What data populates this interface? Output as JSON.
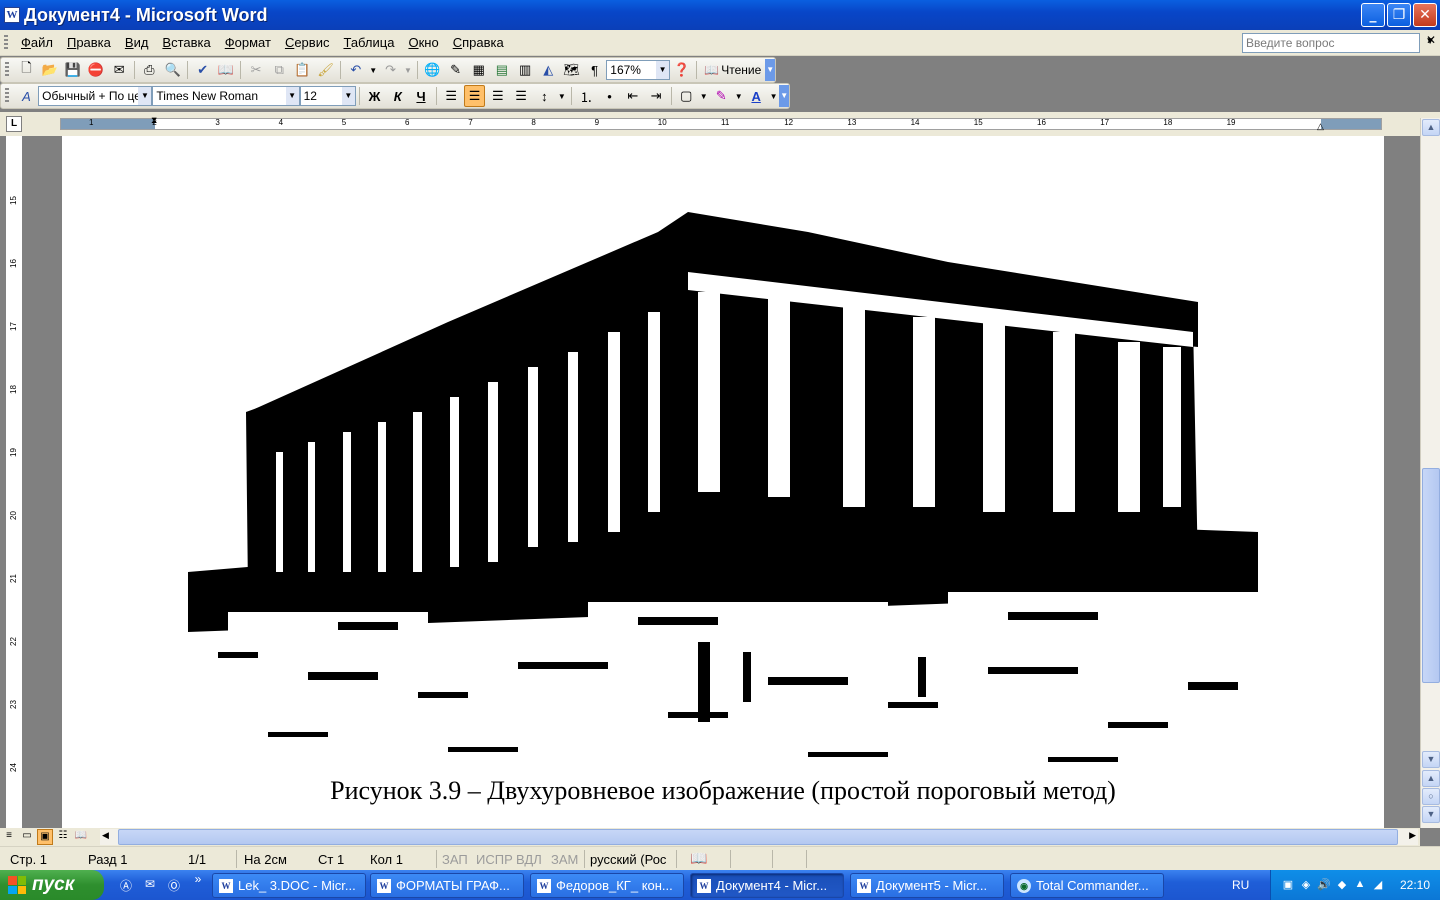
{
  "window": {
    "title": "Документ4 - Microsoft Word",
    "minimize": "_",
    "maximize": "❐",
    "close": "✕"
  },
  "menu": {
    "items": [
      "Файл",
      "Правка",
      "Вид",
      "Вставка",
      "Формат",
      "Сервис",
      "Таблица",
      "Окно",
      "Справка"
    ],
    "ask_placeholder": "Введите вопрос"
  },
  "toolbar_standard": {
    "zoom": "167%",
    "reading_label": "Чтение",
    "icons": [
      "new-icon",
      "open-icon",
      "save-icon",
      "permission-icon",
      "email-icon",
      "print-icon",
      "print-preview-icon",
      "spelling-icon",
      "research-icon",
      "cut-icon",
      "copy-icon",
      "paste-icon",
      "format-painter-icon",
      "undo-icon",
      "redo-icon",
      "hyperlink-icon",
      "tables-borders-icon",
      "insert-table-icon",
      "insert-excel-icon",
      "columns-icon",
      "drawing-icon",
      "document-map-icon",
      "show-formatting-icon",
      "help-icon",
      "reading-icon"
    ]
  },
  "toolbar_format": {
    "style": "Обычный + По це",
    "font": "Times New Roman",
    "size": "12",
    "bold": "Ж",
    "italic": "К",
    "underline": "Ч",
    "icons": [
      "styles-icon",
      "align-left-icon",
      "align-center-icon",
      "align-right-icon",
      "justify-icon",
      "line-spacing-icon",
      "numbering-icon",
      "bullets-icon",
      "decrease-indent-icon",
      "increase-indent-icon",
      "border-icon",
      "highlight-icon",
      "font-color-icon"
    ]
  },
  "ruler": {
    "tab_selector": "L",
    "labels": [
      "1",
      "2",
      "3",
      "4",
      "5",
      "6",
      "7",
      "8",
      "9",
      "10",
      "11",
      "12",
      "13",
      "14",
      "15",
      "16",
      "17",
      "18",
      "19"
    ]
  },
  "vertical_ruler": {
    "labels": [
      "15",
      "16",
      "17",
      "18",
      "19",
      "20",
      "21",
      "22",
      "23",
      "24"
    ]
  },
  "document": {
    "caption": "Рисунок 3.9 – Двухуровневое изображение (простой пороговый метод)"
  },
  "statusbar": {
    "page": "Стр. 1",
    "section": "Разд 1",
    "pages": "1/1",
    "at": "На 2см",
    "line": "Ст 1",
    "col": "Кол 1",
    "rec": "ЗАП",
    "trk": "ИСПР",
    "ext": "ВДЛ",
    "ovr": "ЗАМ",
    "language": "русский (Рос"
  },
  "taskbar": {
    "start": "пуск",
    "tasks": [
      {
        "label": "Lek_ 3.DOC - Micr...",
        "active": false
      },
      {
        "label": "ФОРМАТЫ ГРАФ...",
        "active": false
      },
      {
        "label": "Федоров_КГ_ кон...",
        "active": false
      },
      {
        "label": "Документ4 - Micr...",
        "active": true
      },
      {
        "label": "Документ5 - Micr...",
        "active": false
      },
      {
        "label": "Total Commander...",
        "active": false
      }
    ],
    "language": "RU",
    "clock": "22:10"
  }
}
